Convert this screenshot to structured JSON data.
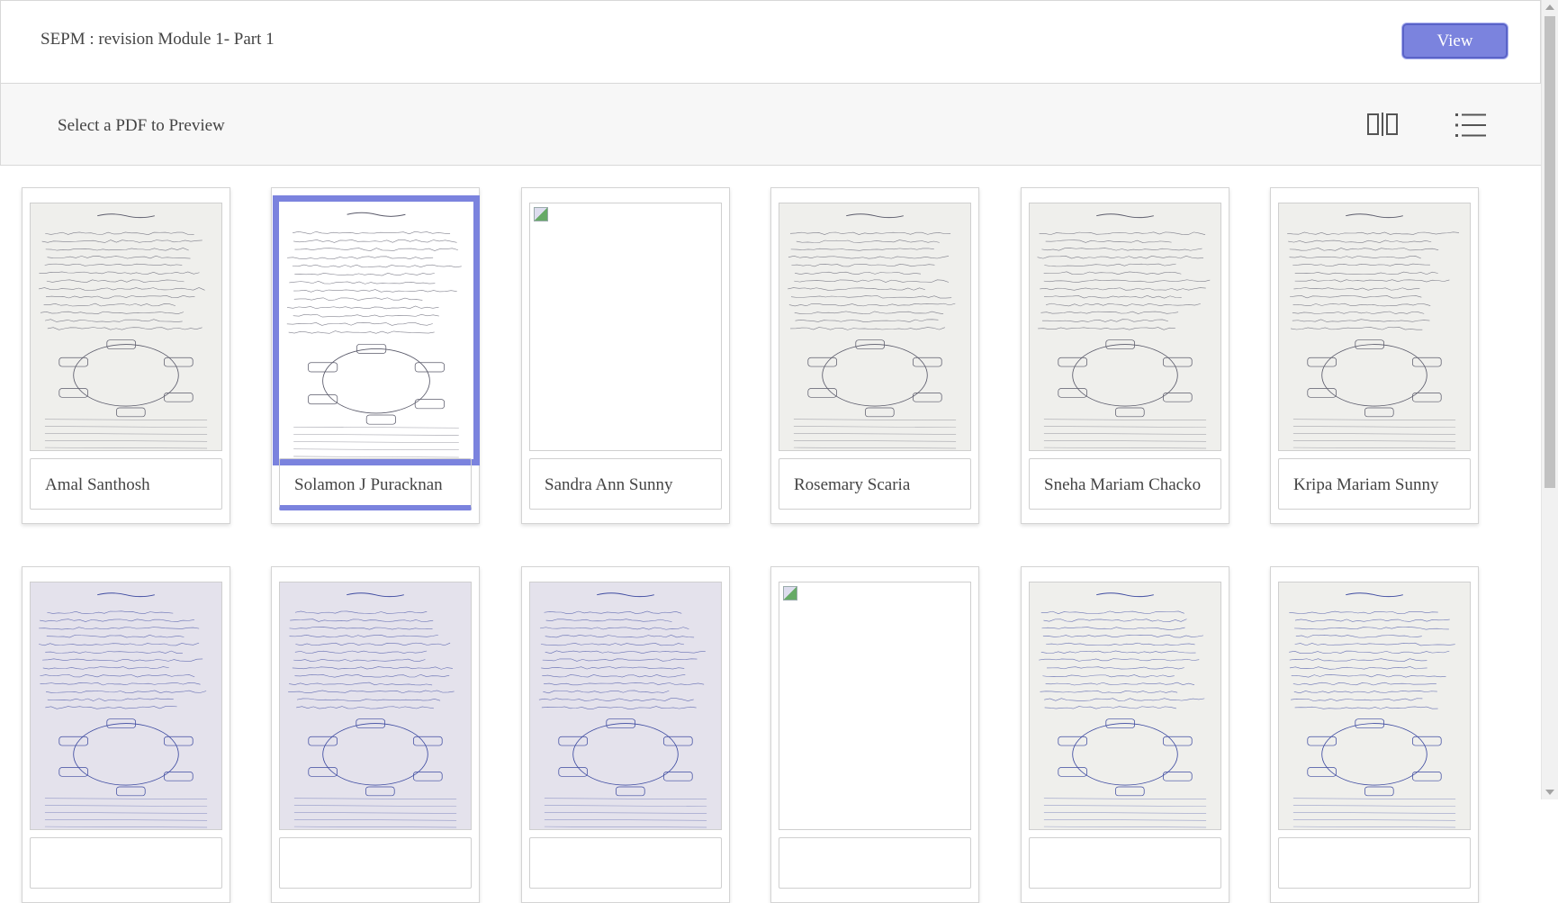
{
  "header": {
    "title": "SEPM : revision Module 1- Part 1",
    "view_label": "View"
  },
  "toolbar": {
    "label": "Select a PDF to Preview",
    "grid_icon": "grid-view-icon",
    "list_icon": "list-view-icon"
  },
  "colors": {
    "accent": "#7b83de",
    "accent_border": "#5a63c8"
  },
  "cards": [
    {
      "name": "Amal Santhosh",
      "state": "loaded"
    },
    {
      "name": "Solamon J Puracknan",
      "state": "loaded",
      "selected": true
    },
    {
      "name": "Sandra Ann Sunny",
      "state": "broken"
    },
    {
      "name": "Rosemary Scaria",
      "state": "loaded"
    },
    {
      "name": "Sneha Mariam Chacko",
      "state": "loaded"
    },
    {
      "name": "Kripa Mariam Sunny",
      "state": "loaded"
    },
    {
      "name": "",
      "state": "loaded"
    },
    {
      "name": "",
      "state": "loaded"
    },
    {
      "name": "",
      "state": "loaded"
    },
    {
      "name": "",
      "state": "broken"
    },
    {
      "name": "",
      "state": "loaded"
    },
    {
      "name": "",
      "state": "loaded"
    }
  ]
}
